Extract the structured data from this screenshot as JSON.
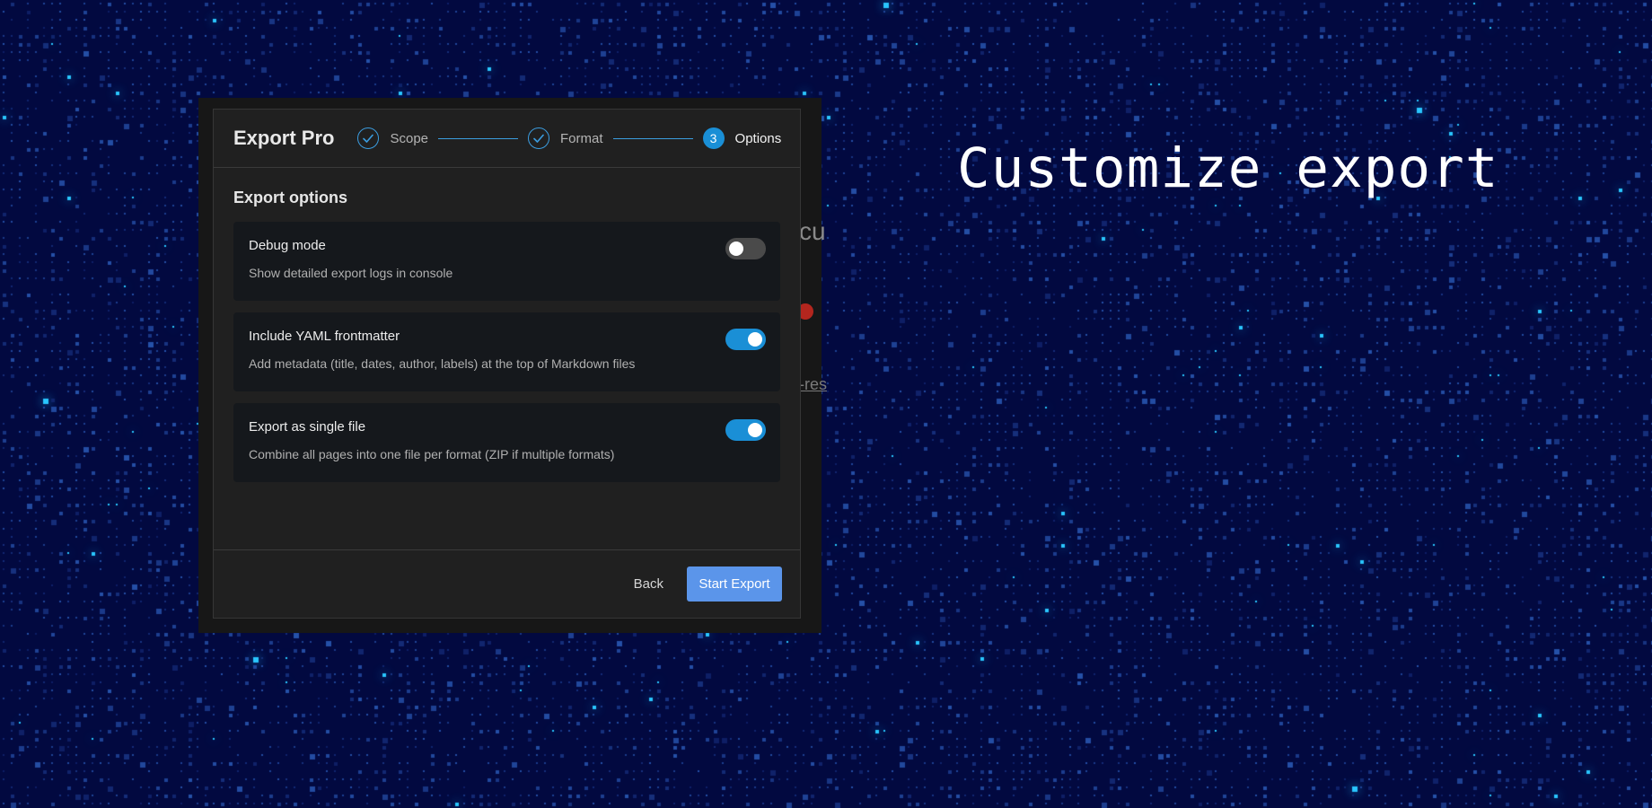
{
  "background": {
    "headline": "Customize export"
  },
  "behind_page": {
    "frag1": "cu",
    "frag3": "-res"
  },
  "modal": {
    "app_title": "Export Pro",
    "steps": [
      {
        "label": "Scope",
        "state": "done",
        "icon": "check-icon"
      },
      {
        "label": "Format",
        "state": "done",
        "icon": "check-icon"
      },
      {
        "number": "3",
        "label": "Options",
        "state": "active"
      }
    ],
    "section_title": "Export options",
    "options": [
      {
        "title": "Debug mode",
        "description": "Show detailed export logs in console",
        "enabled": false
      },
      {
        "title": "Include YAML frontmatter",
        "description": "Add metadata (title, dates, author, labels) at the top of Markdown files",
        "enabled": true
      },
      {
        "title": "Export as single file",
        "description": "Combine all pages into one file per format (ZIP if multiple formats)",
        "enabled": true
      }
    ],
    "footer": {
      "back_label": "Back",
      "start_label": "Start Export"
    }
  },
  "colors": {
    "accent": "#1a8fd6",
    "primary_button": "#5b95ea",
    "modal_background": "#202020",
    "card_background": "#15181c",
    "page_background": "#020940"
  }
}
